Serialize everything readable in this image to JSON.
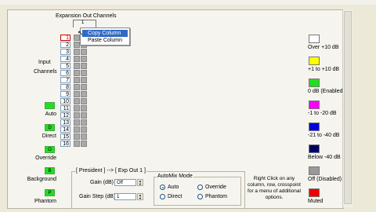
{
  "expansion_header": {
    "title": "Expansion Out Channels",
    "bracket_label": "1"
  },
  "input_channels_label": [
    "Input",
    "Channels"
  ],
  "channel_rows": [
    "1",
    "2",
    "3",
    "4",
    "5",
    "6",
    "7",
    "8",
    "9",
    "10",
    "11",
    "12",
    "13",
    "14",
    "15",
    "16"
  ],
  "context_menu": {
    "copy": "Copy Column",
    "paste": "Paste Column"
  },
  "side_controls": [
    {
      "label": "Auto",
      "swatch": ""
    },
    {
      "label": "Direct",
      "swatch": "D"
    },
    {
      "label": "Override",
      "swatch": "O"
    },
    {
      "label": "Background",
      "swatch": "B"
    },
    {
      "label": "Phantom",
      "swatch": "P"
    }
  ],
  "legend": [
    {
      "label": "Over +10 dB",
      "color": "#ffffff"
    },
    {
      "label": "+1 to +10 dB",
      "color": "#ffff00"
    },
    {
      "label": "0 dB (Enabled)",
      "color": "#22dd22"
    },
    {
      "label": "-1 to -20 dB",
      "color": "#ff00ff"
    },
    {
      "label": "-21 to -40 dB",
      "color": "#0000dd"
    },
    {
      "label": "Below -40 dB",
      "color": "#000066"
    },
    {
      "label": "Off (Disabled)",
      "color": "#999999"
    },
    {
      "label": "Muted",
      "color": "#ee0000"
    }
  ],
  "president_group": {
    "title": "[ President ] --> [ Exp Out 1 ]",
    "gain_label": "Gain (dB)",
    "gain_value": "Off",
    "gain_step_label": "Gain Step (dB)",
    "gain_step_value": "1"
  },
  "automix": {
    "title": "AutoMix Mode",
    "options": [
      "Auto",
      "Override",
      "Direct",
      "Phantom"
    ],
    "selected": "Auto"
  },
  "help_text": "Right Click on any column, row, crosspoint for a menu of additional options."
}
